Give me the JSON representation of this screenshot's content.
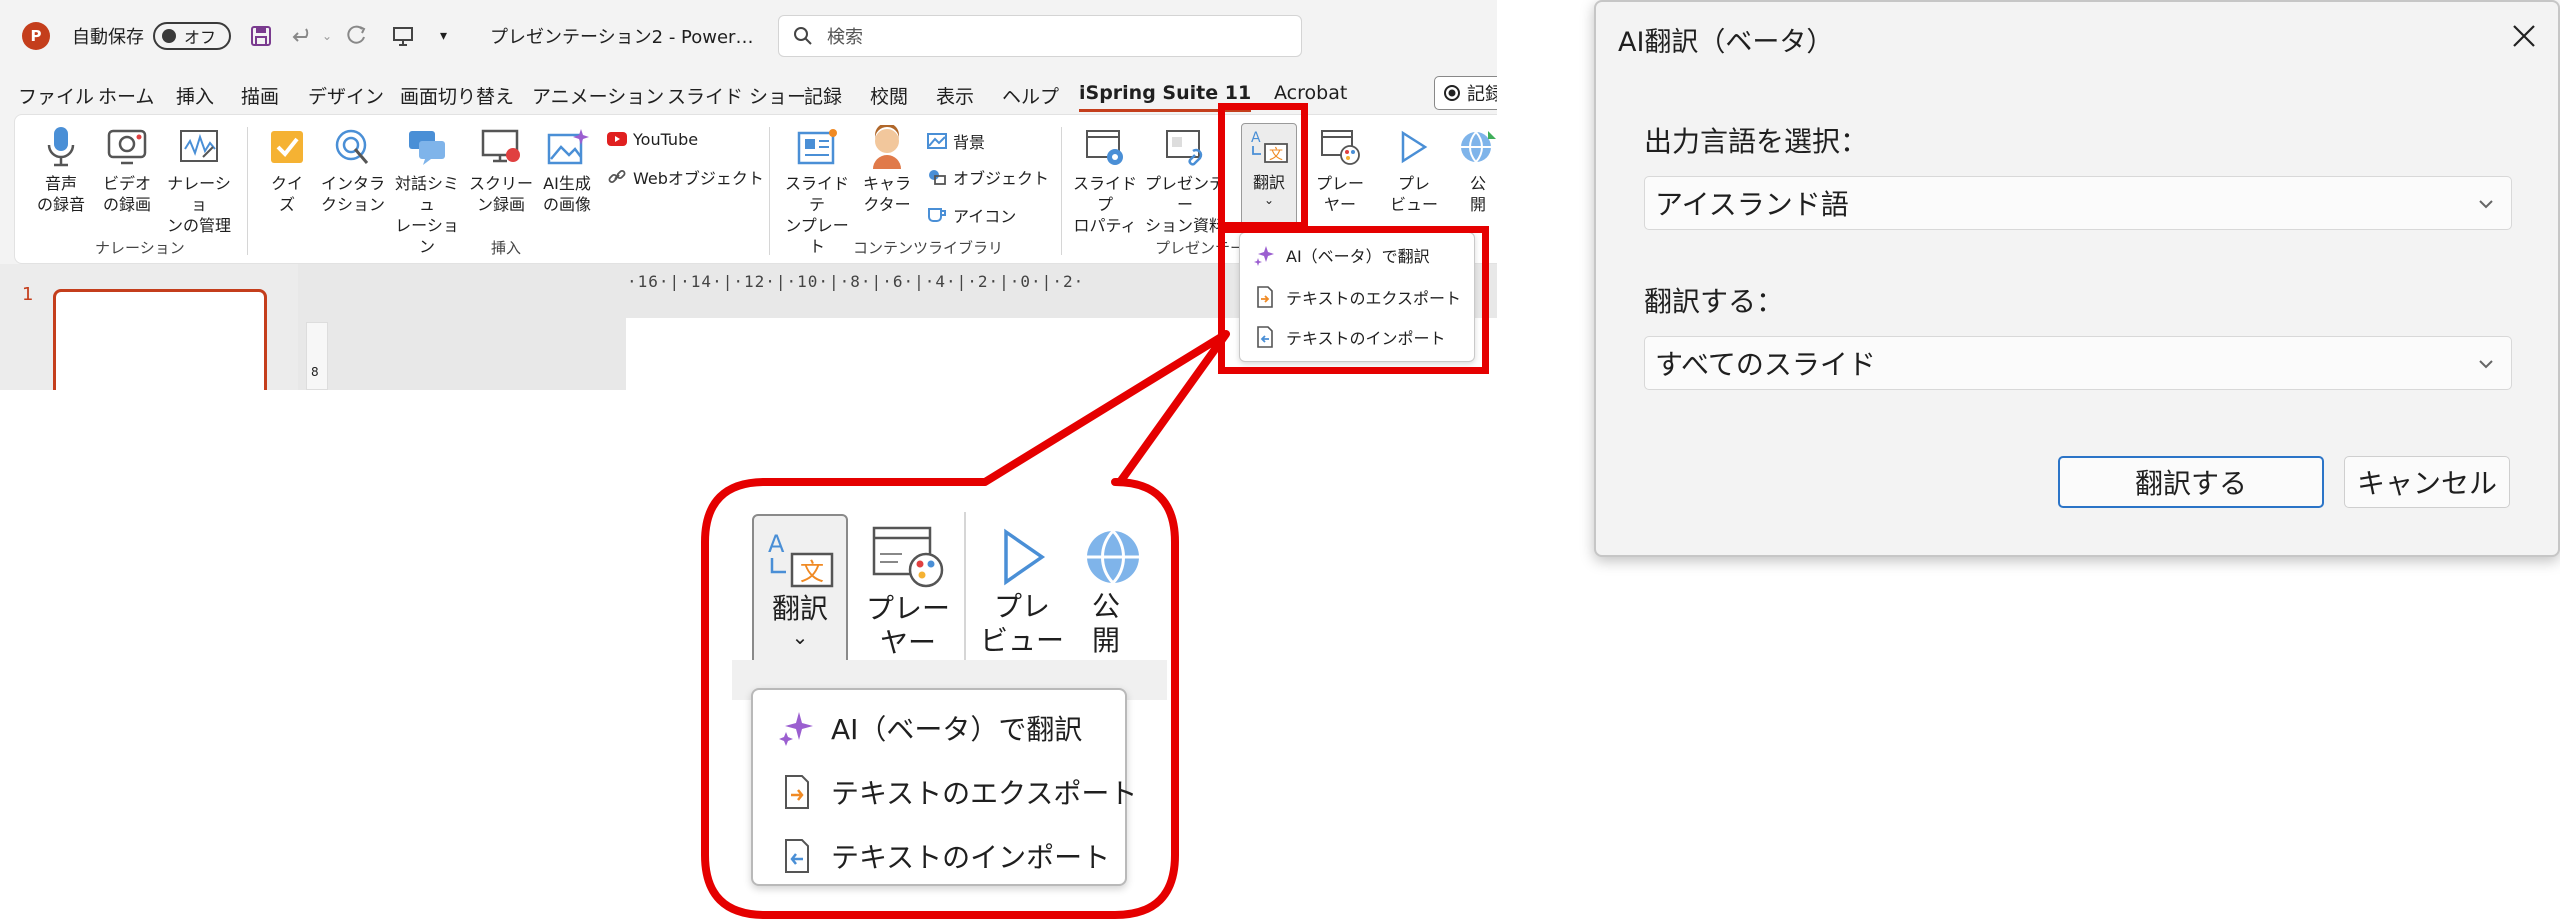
{
  "titlebar": {
    "logo_letter": "P",
    "autosave_label": "自動保存",
    "autosave_state": "オフ",
    "doc_title": "プレゼンテーション2  -  Power…",
    "search_placeholder": "検索"
  },
  "menu": {
    "tabs": [
      "ファイル",
      "ホーム",
      "挿入",
      "描画",
      "デザイン",
      "画面切り替え",
      "アニメーション",
      "スライド ショー",
      "記録",
      "校閲",
      "表示",
      "ヘルプ",
      "iSpring Suite 11",
      "Acrobat"
    ],
    "active_tab": "iSpring Suite 11",
    "record_label": "記録"
  },
  "ribbon": {
    "narration": {
      "group_label": "ナレーション",
      "buttons": [
        "音声\nの録音",
        "ビデオ\nの録画",
        "ナレーショ\nンの管理"
      ]
    },
    "insert": {
      "group_label": "挿入",
      "buttons": [
        "クイ\nズ",
        "インタラ\nクション",
        "対話シミュ\nレーション",
        "スクリー\nン録画",
        "AI生成\nの画像"
      ],
      "small": [
        "YouTube",
        "Webオブジェクト"
      ]
    },
    "content_library": {
      "group_label": "コンテンツライブラリ",
      "buttons": [
        "スライドテ\nンプレート",
        "キャラ\nクター"
      ],
      "small": [
        "背景",
        "オブジェクト",
        "アイコン"
      ]
    },
    "presentation": {
      "group_label": "プレゼンテー",
      "buttons": [
        "スライドプ\nロパティ",
        "プレゼンテー\nション資料",
        "翻訳",
        "プレー\nヤー",
        "プレ\nビュー",
        "公\n開"
      ]
    }
  },
  "workspace": {
    "slide_number": "1",
    "ruler_text": "·16·|·14·|·12·|·10·|·8·|·6·|·4·|·2·|·0·|·2·",
    "vruler_text": "8"
  },
  "dropdown": {
    "items": [
      "AI（ベータ）で翻訳",
      "テキストのエクスポート",
      "テキストのインポート"
    ]
  },
  "zoom": {
    "translate_label": "翻訳",
    "player_label": "プレー\nヤー",
    "preview_label": "プレ\nビュー",
    "publish_label": "公\n開",
    "items": [
      "AI（ベータ）で翻訳",
      "テキストのエクスポート",
      "テキストのインポート"
    ]
  },
  "dialog": {
    "title": "AI翻訳（ベータ）",
    "output_lang_label": "出力言語を選択：",
    "output_lang_value": "アイスランド語",
    "translate_scope_label": "翻訳する：",
    "translate_scope_value": "すべてのスライド",
    "translate_button": "翻訳する",
    "cancel_button": "キャンセル"
  },
  "colors": {
    "highlight_red": "#e50000",
    "ppt_accent": "#c43e1c",
    "primary_button_border": "#2b74c7"
  }
}
